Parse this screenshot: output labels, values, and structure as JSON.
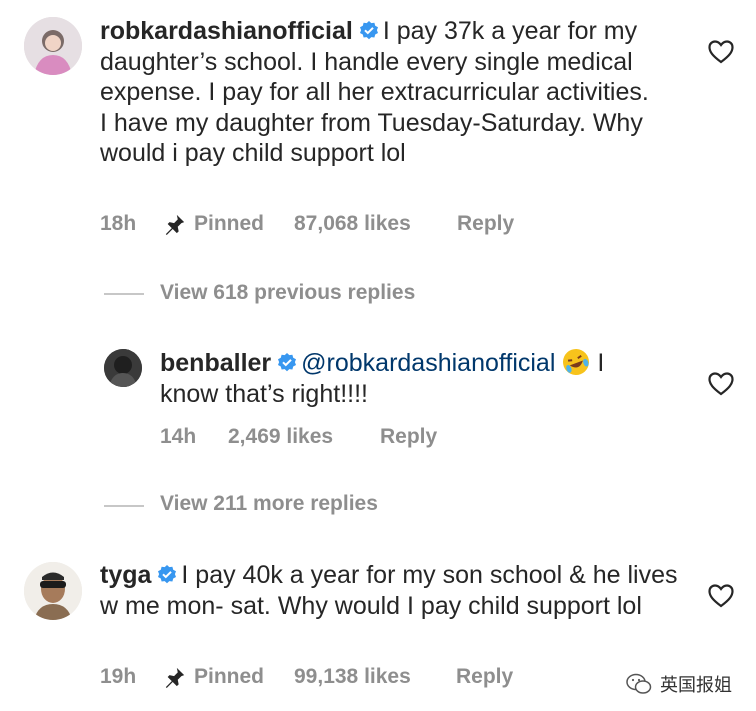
{
  "comments": [
    {
      "username": "robkardashianofficial",
      "text": "I pay 37k a year for my daughter’s school. I handle every single medical expense. I pay for all her extracurricular activities. I have my daughter from Tuesday-Saturday. Why would i pay child support lol",
      "time": "18h",
      "pinned_label": "Pinned",
      "likes": "87,068 likes",
      "reply_label": "Reply",
      "view_replies": "View 618 previous replies"
    },
    {
      "username": "benballer",
      "mention": "@robkardashianofficial",
      "text_after_emoji": "I",
      "text_line2": "know that’s right!!!!",
      "time": "14h",
      "likes": "2,469 likes",
      "reply_label": "Reply",
      "view_replies": "View 211 more replies"
    },
    {
      "username": "tyga",
      "text": "I pay 40k a year for my son school & he lives  w me mon- sat. Why would I pay child support lol",
      "time": "19h",
      "pinned_label": "Pinned",
      "likes": "99,138 likes",
      "reply_label": "Reply"
    }
  ],
  "watermark": {
    "text": "英国报姐"
  },
  "colors": {
    "text": "#262626",
    "meta": "#8e8e8e",
    "mention": "#00376b",
    "verified": "#3897f0"
  }
}
